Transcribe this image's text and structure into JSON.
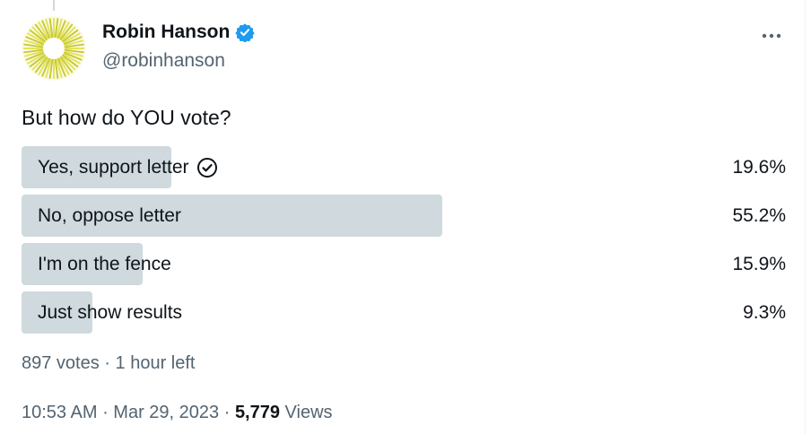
{
  "author": {
    "display_name": "Robin Hanson",
    "handle": "@robinhanson",
    "verified": true,
    "avatar_icon": "sunburst-avatar"
  },
  "tweet": {
    "text": "But how do YOU vote?"
  },
  "poll": {
    "options": [
      {
        "label": "Yes, support letter",
        "percent_text": "19.6%",
        "percent": 19.6,
        "selected": true
      },
      {
        "label": "No, oppose letter",
        "percent_text": "55.2%",
        "percent": 55.2,
        "selected": false
      },
      {
        "label": "I'm on the fence",
        "percent_text": "15.9%",
        "percent": 15.9,
        "selected": false
      },
      {
        "label": "Just show results",
        "percent_text": "9.3%",
        "percent": 9.3,
        "selected": false
      }
    ],
    "votes_text": "897 votes",
    "separator": " · ",
    "time_left": "1 hour left"
  },
  "meta": {
    "time": "10:53 AM",
    "date": "Mar 29, 2023",
    "separator": " · ",
    "views_count": "5,779",
    "views_label": " Views"
  },
  "colors": {
    "bar": "#cfd9de",
    "verified": "#1d9bf0",
    "secondary_text": "#536471"
  }
}
